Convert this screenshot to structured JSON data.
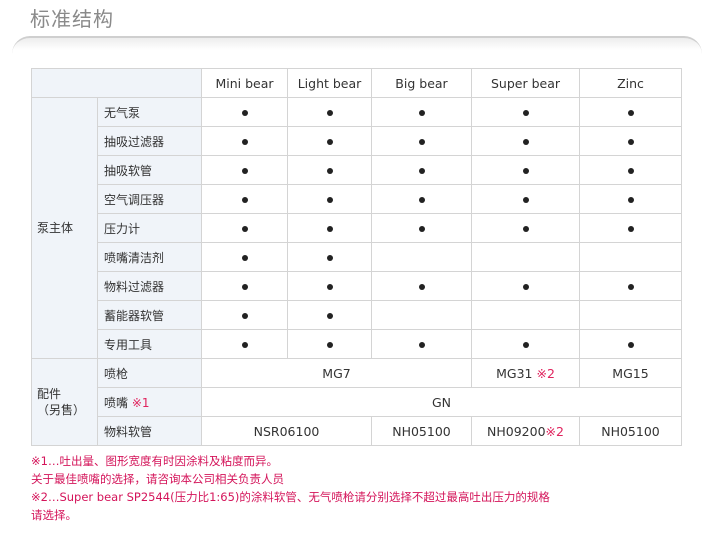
{
  "title": "标准结构",
  "models": [
    "Mini bear",
    "Light bear",
    "Big bear",
    "Super bear",
    "Zinc"
  ],
  "groups": {
    "main": "泵主体",
    "accessory": "配件",
    "accessory_sub": "（另售）"
  },
  "main_rows": [
    {
      "label": "无气泵",
      "marks": [
        true,
        true,
        true,
        true,
        true
      ]
    },
    {
      "label": "抽吸过滤器",
      "marks": [
        true,
        true,
        true,
        true,
        true
      ]
    },
    {
      "label": "抽吸软管",
      "marks": [
        true,
        true,
        true,
        true,
        true
      ]
    },
    {
      "label": "空气调压器",
      "marks": [
        true,
        true,
        true,
        true,
        true
      ]
    },
    {
      "label": "压力计",
      "marks": [
        true,
        true,
        true,
        true,
        true
      ]
    },
    {
      "label": "喷嘴清洁剂",
      "marks": [
        true,
        true,
        false,
        false,
        false
      ]
    },
    {
      "label": "物料过滤器",
      "marks": [
        true,
        true,
        true,
        true,
        true
      ]
    },
    {
      "label": "蓄能器软管",
      "marks": [
        true,
        true,
        false,
        false,
        false
      ]
    },
    {
      "label": "专用工具",
      "marks": [
        true,
        true,
        true,
        true,
        true
      ]
    }
  ],
  "accessory_rows": {
    "gun": {
      "label": "喷枪",
      "mg7": "MG7",
      "mg31": "MG31",
      "mg31_note": "※2",
      "mg15": "MG15"
    },
    "nozzle": {
      "label": "喷嘴",
      "label_note": "※1",
      "value": "GN"
    },
    "hose": {
      "label": "物料软管",
      "v1": "NSR06100",
      "v2": "NH05100",
      "v3": "NH09200",
      "v3_note": "※2",
      "v4": "NH05100"
    }
  },
  "notes": [
    "※1…吐出量、图形宽度有时因涂料及粘度而异。",
    "关于最佳喷嘴的选择，请咨询本公司相关负责人员",
    "※2…Super bear SP2544(压力比1:65)的涂料软管、无气喷枪请分别选择不超过最高吐出压力的规格",
    "请选择。"
  ]
}
